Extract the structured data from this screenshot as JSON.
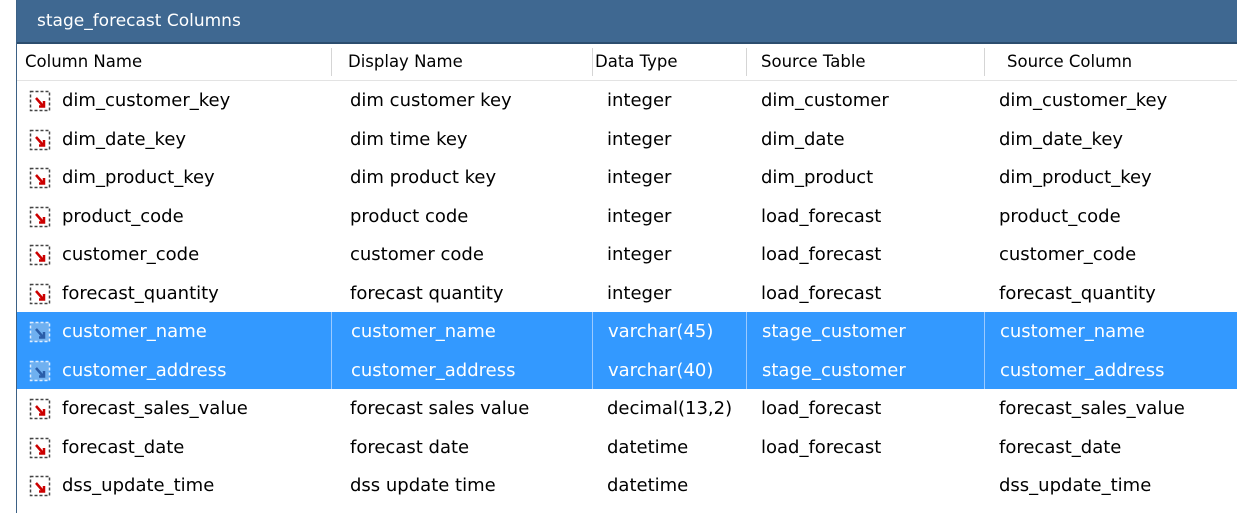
{
  "window": {
    "title": "stage_forecast Columns"
  },
  "columns": [
    "Column Name",
    "Display Name",
    "Data Type",
    "Source Table",
    "Source Column"
  ],
  "rows": [
    {
      "column_name": "dim_customer_key",
      "display_name": "dim customer key",
      "data_type": "integer",
      "source_table": "dim_customer",
      "source_column": "dim_customer_key",
      "selected": false,
      "icon": "column-icon"
    },
    {
      "column_name": "dim_date_key",
      "display_name": "dim time key",
      "data_type": "integer",
      "source_table": "dim_date",
      "source_column": "dim_date_key",
      "selected": false,
      "icon": "column-icon"
    },
    {
      "column_name": "dim_product_key",
      "display_name": "dim product key",
      "data_type": "integer",
      "source_table": "dim_product",
      "source_column": "dim_product_key",
      "selected": false,
      "icon": "column-icon"
    },
    {
      "column_name": "product_code",
      "display_name": "product code",
      "data_type": "integer",
      "source_table": "load_forecast",
      "source_column": "product_code",
      "selected": false,
      "icon": "column-icon"
    },
    {
      "column_name": "customer_code",
      "display_name": "customer code",
      "data_type": "integer",
      "source_table": "load_forecast",
      "source_column": "customer_code",
      "selected": false,
      "icon": "column-icon"
    },
    {
      "column_name": "forecast_quantity",
      "display_name": "forecast quantity",
      "data_type": "integer",
      "source_table": "load_forecast",
      "source_column": "forecast_quantity",
      "selected": false,
      "icon": "column-icon"
    },
    {
      "column_name": "customer_name",
      "display_name": "customer_name",
      "data_type": "varchar(45)",
      "source_table": "stage_customer",
      "source_column": "customer_name",
      "selected": true,
      "icon": "column-icon"
    },
    {
      "column_name": "customer_address",
      "display_name": "customer_address",
      "data_type": "varchar(40)",
      "source_table": "stage_customer",
      "source_column": "customer_address",
      "selected": true,
      "icon": "column-icon"
    },
    {
      "column_name": "forecast_sales_value",
      "display_name": "forecast sales value",
      "data_type": "decimal(13,2)",
      "source_table": "load_forecast",
      "source_column": "forecast_sales_value",
      "selected": false,
      "icon": "column-icon"
    },
    {
      "column_name": "forecast_date",
      "display_name": "forecast date",
      "data_type": "datetime",
      "source_table": "load_forecast",
      "source_column": "forecast_date",
      "selected": false,
      "icon": "column-icon"
    },
    {
      "column_name": "dss_update_time",
      "display_name": "dss update time",
      "data_type": "datetime",
      "source_table": "",
      "source_column": "dss_update_time",
      "selected": false,
      "icon": "column-icon"
    }
  ],
  "colors": {
    "title_bar": "#3f6891",
    "selection": "#3399ff",
    "icon_arrow": "#cc0000"
  }
}
